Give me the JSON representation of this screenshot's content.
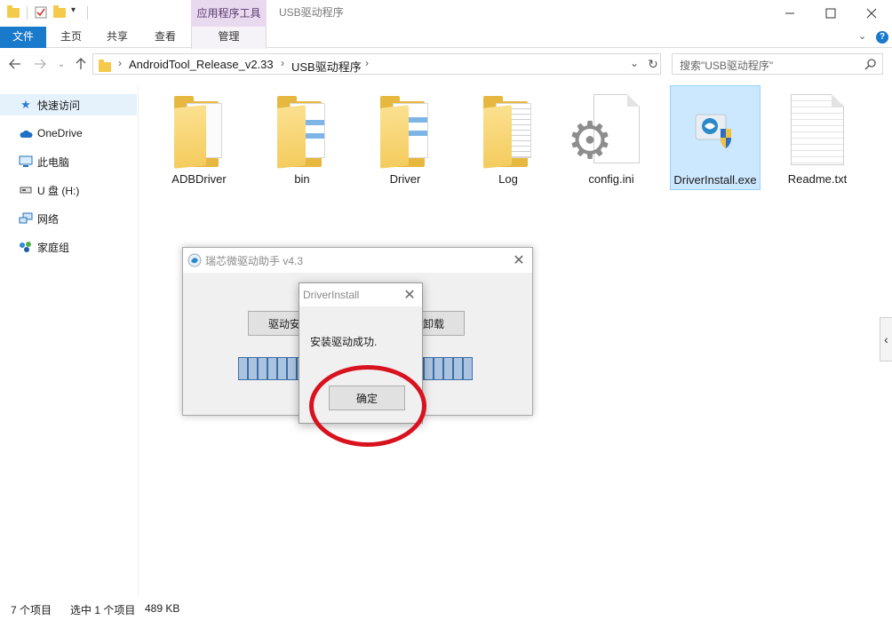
{
  "titlebar": {
    "context_tab": "应用程序工具",
    "window_title": "USB驱动程序"
  },
  "ribbon": {
    "tabs": [
      "文件",
      "主页",
      "共享",
      "查看",
      "管理"
    ]
  },
  "address": {
    "crumbs": [
      "AndroidTool_Release_v2.33",
      "USB驱动程序"
    ],
    "search_placeholder": "搜索\"USB驱动程序\""
  },
  "sidebar": {
    "items": [
      {
        "label": "快速访问",
        "icon": "star-icon"
      },
      {
        "label": "OneDrive",
        "icon": "cloud-icon"
      },
      {
        "label": "此电脑",
        "icon": "computer-icon"
      },
      {
        "label": "U 盘 (H:)",
        "icon": "usb-drive-icon"
      },
      {
        "label": "网络",
        "icon": "network-icon"
      },
      {
        "label": "家庭组",
        "icon": "homegroup-icon"
      }
    ]
  },
  "files": [
    {
      "name": "ADBDriver",
      "type": "folder"
    },
    {
      "name": "bin",
      "type": "folder"
    },
    {
      "name": "Driver",
      "type": "folder"
    },
    {
      "name": "Log",
      "type": "folder"
    },
    {
      "name": "config.ini",
      "type": "config"
    },
    {
      "name": "DriverInstall.exe",
      "type": "exe",
      "selected": true
    },
    {
      "name": "Readme.txt",
      "type": "text"
    }
  ],
  "helper_dialog": {
    "title": "瑞芯微驱动助手 v4.3",
    "install_button": "驱动安装",
    "uninstall_button": "驱动卸载",
    "progress_segments": 24
  },
  "message_box": {
    "title": "DriverInstall",
    "text": "安装驱动成功.",
    "ok_button": "确定"
  },
  "status": {
    "count": "7 个项目",
    "selection": "选中 1 个项目",
    "size": "489 KB"
  },
  "colors": {
    "file_tab": "#1979ca",
    "highlight": "#d8121e",
    "selection": "#cce8ff",
    "context_tab": "#e8d9ef"
  }
}
